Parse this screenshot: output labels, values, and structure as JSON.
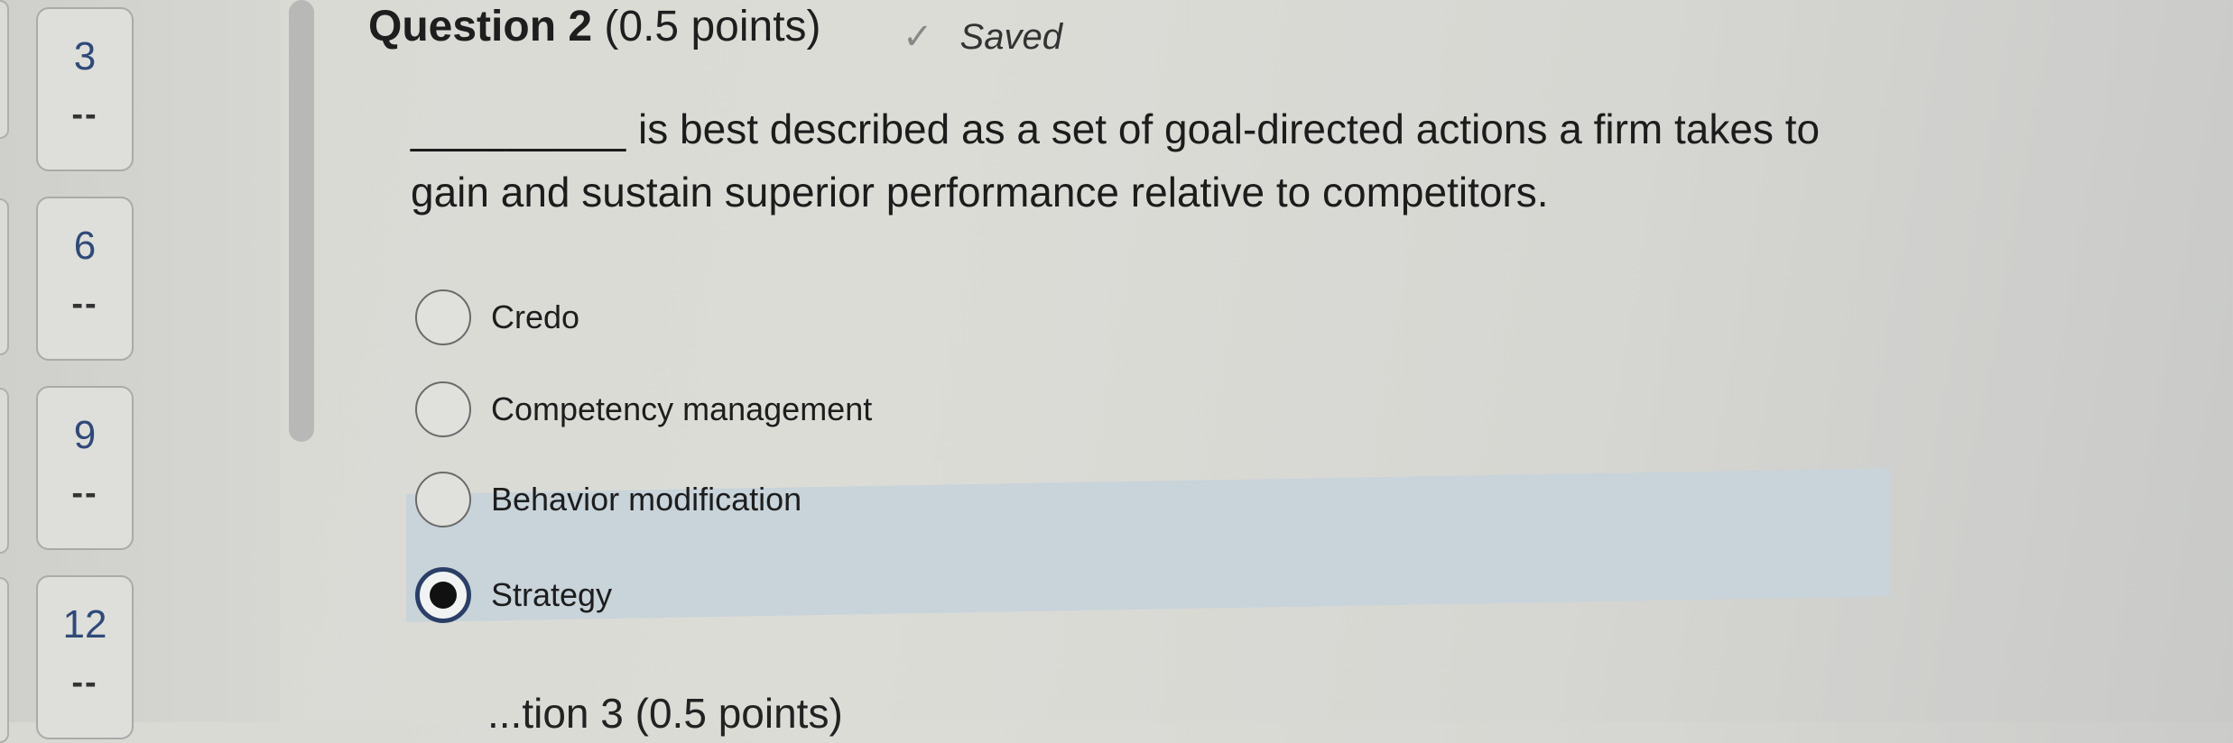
{
  "sidebar": {
    "items": [
      {
        "number": "3",
        "status": "--"
      },
      {
        "number": "6",
        "status": "--"
      },
      {
        "number": "9",
        "status": "--"
      },
      {
        "number": "12",
        "status": "--"
      }
    ]
  },
  "question": {
    "title_bold": "Question 2",
    "title_points": "(0.5 points)",
    "saved_label": "Saved",
    "blank": "_________",
    "text": " is best described as a set of goal-directed actions a firm takes to gain and sustain superior performance relative to competitors.",
    "options": [
      {
        "label": "Credo",
        "selected": false
      },
      {
        "label": "Competency management",
        "selected": false
      },
      {
        "label": "Behavior modification",
        "selected": false
      },
      {
        "label": "Strategy",
        "selected": true
      }
    ]
  },
  "next_question_partial": "...tion 3 (0.5 points)"
}
